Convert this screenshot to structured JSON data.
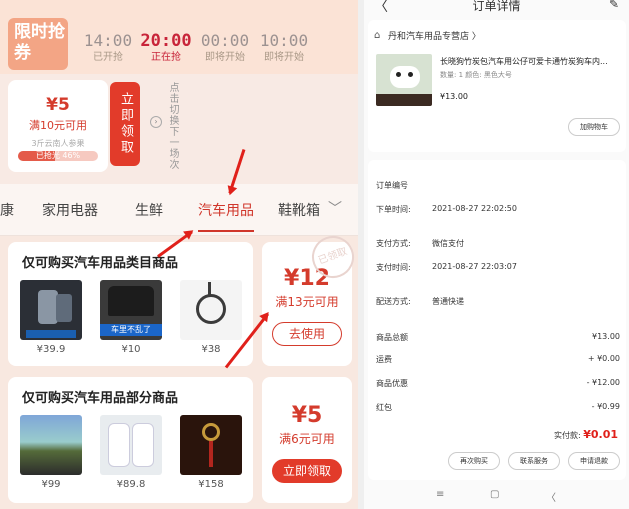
{
  "flash": {
    "tag": "限时抢券",
    "slots": [
      {
        "time": "14:00",
        "status": "已开抢"
      },
      {
        "time": "20:00",
        "status": "正在抢"
      },
      {
        "time": "00:00",
        "status": "即将开始"
      },
      {
        "time": "10:00",
        "status": "即将开始"
      }
    ]
  },
  "top_coupon": {
    "amount": "¥5",
    "condition": "满10元可用",
    "note": "3斤云南人参果",
    "progress_text": "已抢光 46%",
    "progress": 0.46,
    "claim_label": "立即领取",
    "switch_text": "点击切换下一场次"
  },
  "categories": {
    "items": [
      "健康",
      "家用电器",
      "生鲜",
      "汽车用品",
      "鞋靴箱"
    ],
    "active": "汽车用品",
    "more_icon": "chevron-down-icon"
  },
  "section1": {
    "title": "仅可购买汽车用品类目商品",
    "products": [
      {
        "price": "¥39.9",
        "img_text": "A"
      },
      {
        "price": "¥10",
        "img_text": "车里不乱了"
      },
      {
        "price": "¥38",
        "img_text": ""
      }
    ],
    "coupon_amount": "¥12",
    "coupon_condition": "满13元可用",
    "button": "去使用",
    "stamp": "已领取"
  },
  "section2": {
    "title": "仅可购买汽车用品部分商品",
    "products": [
      {
        "price": "¥99"
      },
      {
        "price": "¥89.8"
      },
      {
        "price": "¥158"
      }
    ],
    "coupon_amount": "¥5",
    "coupon_condition": "满6元可用",
    "button": "立即领取"
  },
  "order": {
    "header_title": "订单详情",
    "shop_name": "丹和汽车用品专营店 〉",
    "product_title": "长晓狗竹炭包汽车用公仔可爱卡通竹炭狗车内...",
    "product_spec": "数量: 1 颜色: 黑色大号",
    "product_price": "¥13.00",
    "add_cart": "加购物车",
    "info": [
      {
        "k": "订单编号",
        "v": ""
      },
      {
        "k": "下单时间:",
        "v": "2021-08-27 22:02:50"
      },
      {
        "k": "支付方式:",
        "v": "微信支付"
      },
      {
        "k": "支付时间:",
        "v": "2021-08-27 22:03:07"
      },
      {
        "k": "配送方式:",
        "v": "普通快递"
      }
    ],
    "amounts": [
      {
        "k": "商品总额",
        "v": "¥13.00"
      },
      {
        "k": "运费",
        "v": "+ ¥0.00"
      },
      {
        "k": "商品优惠",
        "v": "- ¥12.00"
      },
      {
        "k": "红包",
        "v": "- ¥0.99"
      }
    ],
    "paid_label": "实付款:",
    "paid_amount": "¥0.01",
    "actions": [
      "再次购买",
      "联系服务",
      "申请退款"
    ]
  },
  "nav": {
    "menu": "≡",
    "home": "▢",
    "back": "〈"
  }
}
